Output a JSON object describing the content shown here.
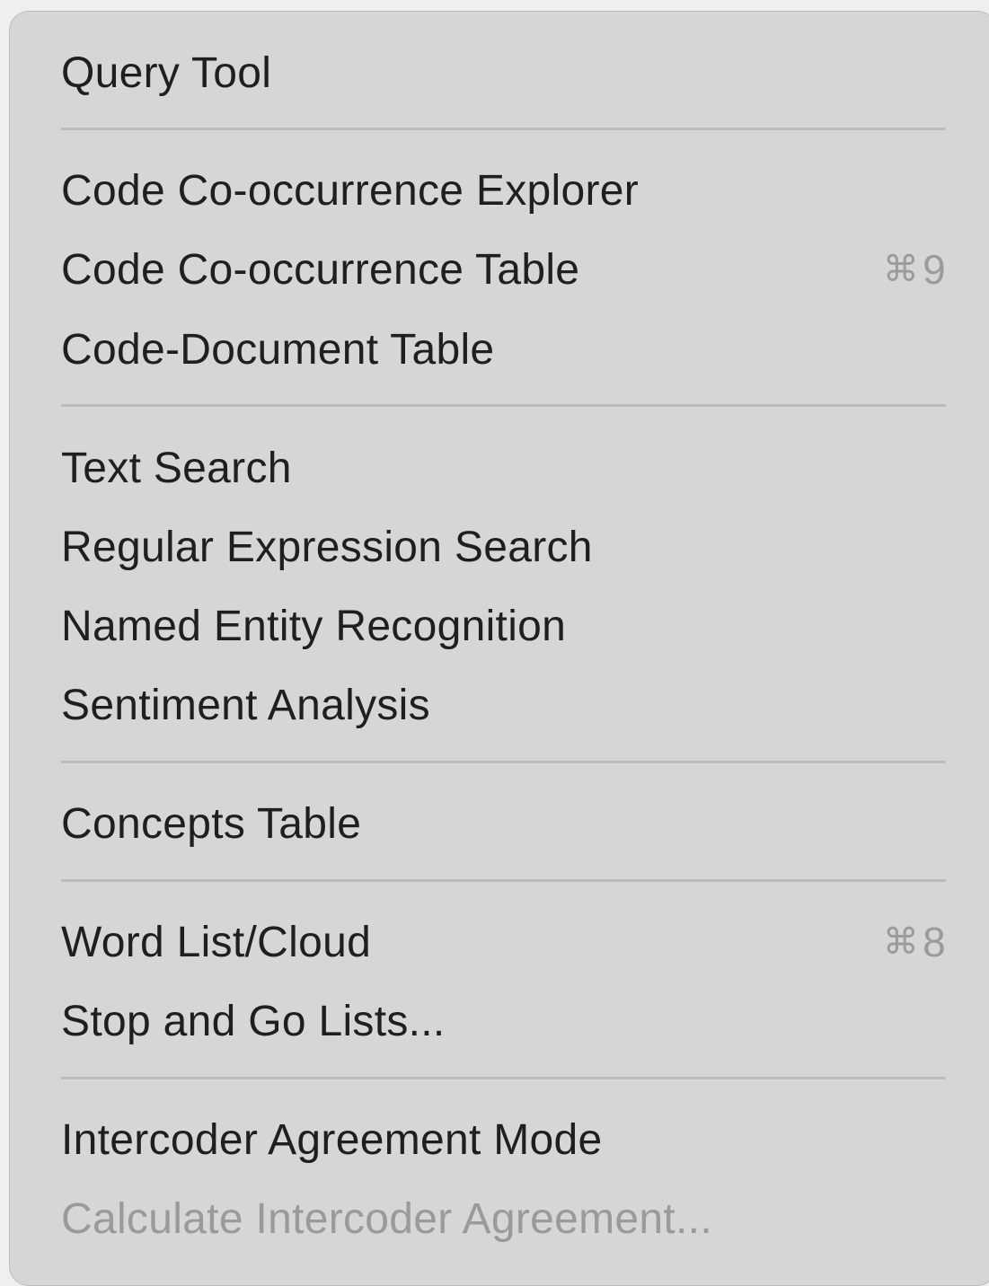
{
  "menu": {
    "items": [
      {
        "label": "Query Tool"
      },
      {
        "label": "Code Co-occurrence Explorer"
      },
      {
        "label": "Code Co-occurrence Table",
        "shortcut_key": "9",
        "shortcut_icon": "command-icon"
      },
      {
        "label": "Code-Document Table"
      },
      {
        "label": "Text Search"
      },
      {
        "label": "Regular Expression Search"
      },
      {
        "label": "Named Entity Recognition"
      },
      {
        "label": "Sentiment Analysis"
      },
      {
        "label": "Concepts Table"
      },
      {
        "label": "Word List/Cloud",
        "shortcut_key": "8",
        "shortcut_icon": "command-icon"
      },
      {
        "label": "Stop and Go Lists..."
      },
      {
        "label": "Intercoder Agreement Mode"
      },
      {
        "label": "Calculate Intercoder Agreement...",
        "disabled": true
      }
    ]
  }
}
